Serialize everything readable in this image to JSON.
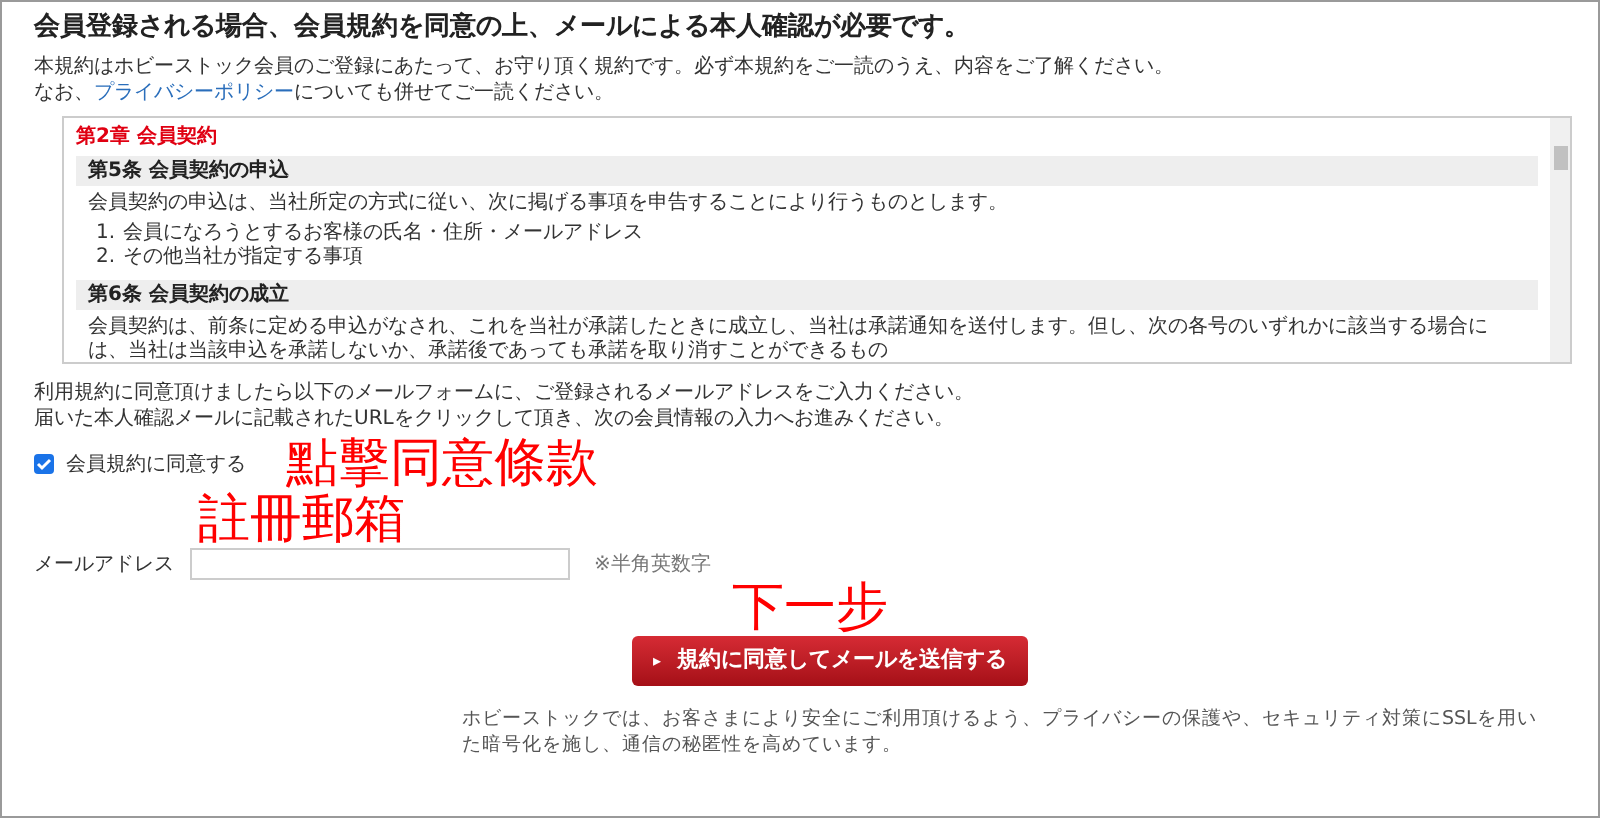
{
  "heading": "会員登録される場合、会員規約を同意の上、メールによる本人確認が必要です。",
  "intro": [
    "本規約はホビーストック会員のご登録にあたって、お守り頂く規約です。必ず本規約をご一読のうえ、内容をご了解ください。",
    {
      "before": "なお、",
      "link": "プライバシーポリシー",
      "after": "についても併せてご一読ください。"
    }
  ],
  "terms": {
    "chapter": "第2章 会員契約",
    "sections": [
      {
        "title": "第5条 会員契約の申込",
        "paragraph": "会員契約の申込は、当社所定の方式に従い、次に掲げる事項を申告することにより行うものとします。",
        "list": [
          {
            "number": "1.",
            "text": "会員になろうとするお客様の氏名・住所・メールアドレス"
          },
          {
            "number": "2.",
            "text": "その他当社が指定する事項"
          }
        ]
      },
      {
        "title": "第6条 会員契約の成立",
        "paragraph": "会員契約は、前条に定める申込がなされ、これを当社が承諾したときに成立し、当社は承諾通知を送付します。但し、次の各号のいずれかに該当する場合には、当社は当該申込を承諾しないか、承諾後であっても承諾を取り消すことができるもの"
      }
    ]
  },
  "instructions": [
    "利用規約に同意頂けましたら以下のメールフォームに、ご登録されるメールアドレスをご入力ください。",
    "届いた本人確認メールに記載されたURLをクリックして頂き、次の会員情報の入力へお進みください。"
  ],
  "agree": {
    "label": "会員規約に同意する",
    "checked": true
  },
  "email": {
    "label": "メールアドレス",
    "note": "※半角英数字"
  },
  "submit": {
    "icon": "▸",
    "label": "規約に同意してメールを送信する"
  },
  "footer": "ホビーストックでは、お客さまにより安全にご利用頂けるよう、プライバシーの保護や、セキュリティ対策にSSLを用いた暗号化を施し、通信の秘匿性を高めています。",
  "annotations": [
    {
      "kind": "agree",
      "text": "點擊同意條款"
    },
    {
      "kind": "email",
      "text": "註冊郵箱"
    },
    {
      "kind": "next",
      "text": "下一步"
    }
  ]
}
